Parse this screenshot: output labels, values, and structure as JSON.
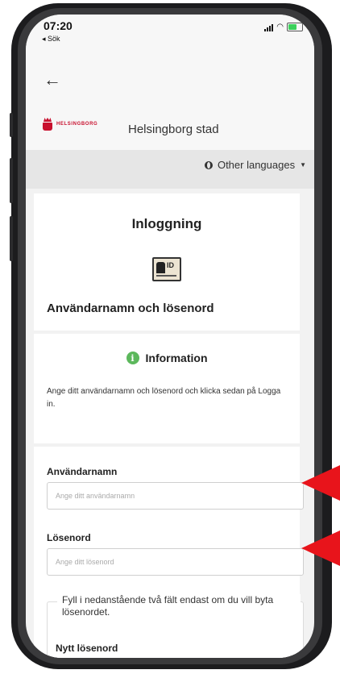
{
  "status_bar": {
    "time": "07:20",
    "back_app": "◂ Sök"
  },
  "header": {
    "back_symbol": "←",
    "logo_text": "HELSINGBORG",
    "site_title": "Helsingborg stad"
  },
  "language": {
    "label": "Other languages"
  },
  "login_card": {
    "title": "Inloggning",
    "id_icon_text": "ID",
    "method": "Användarnamn och lösenord"
  },
  "info_card": {
    "title": "Information",
    "body": "Ange ditt användarnamn och lösenord och klicka sedan på Logga in."
  },
  "form": {
    "username_label": "Användarnamn",
    "username_placeholder": "Ange ditt användarnamn",
    "password_label": "Lösenord",
    "password_placeholder": "Ange ditt lösenord",
    "change_note": "Fyll i nedanstående två fält endast om du vill byta lösenordet.",
    "new_password_label": "Nytt lösenord"
  },
  "colors": {
    "brand_red": "#c8102e",
    "info_green": "#5cb85c",
    "annotation_red": "#e8141b"
  }
}
